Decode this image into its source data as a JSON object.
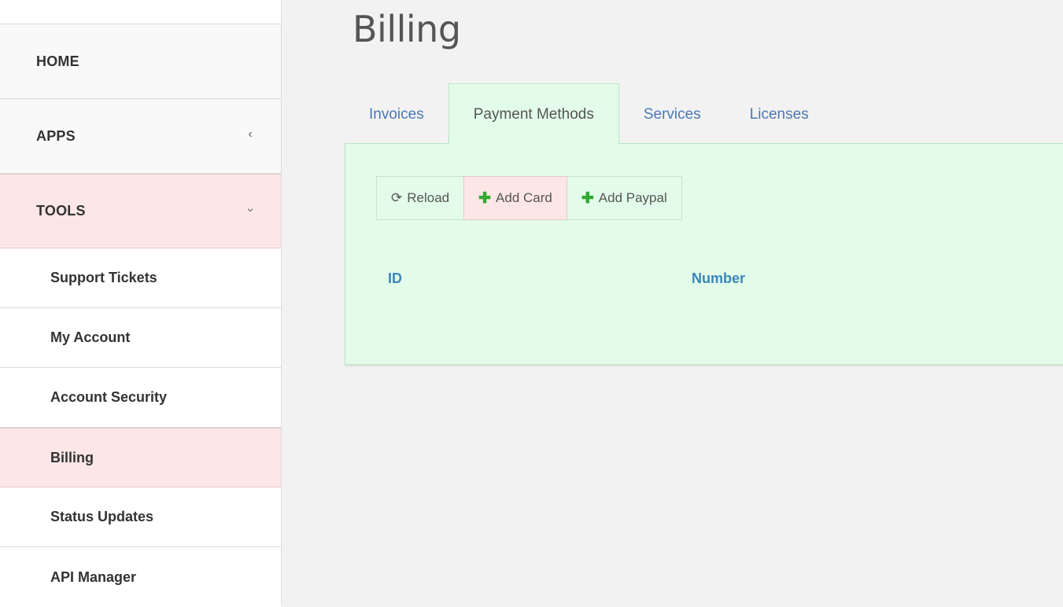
{
  "sidebar": {
    "items": [
      {
        "label": "HOME",
        "chevron": ""
      },
      {
        "label": "APPS",
        "chevron": "‹"
      },
      {
        "label": "TOOLS",
        "chevron": "›"
      }
    ],
    "subitems": [
      {
        "label": "Support Tickets"
      },
      {
        "label": "My Account"
      },
      {
        "label": "Account Security"
      },
      {
        "label": "Billing"
      },
      {
        "label": "Status Updates"
      },
      {
        "label": "API Manager"
      }
    ]
  },
  "page": {
    "title": "Billing"
  },
  "tabs": [
    {
      "label": "Invoices"
    },
    {
      "label": "Payment Methods"
    },
    {
      "label": "Services"
    },
    {
      "label": "Licenses"
    }
  ],
  "toolbar": {
    "reload_icon": "⟳",
    "reload_label": "Reload",
    "plus_icon": "✚",
    "add_card_label": "Add Card",
    "add_paypal_label": "Add Paypal"
  },
  "table": {
    "columns": [
      "ID",
      "Number"
    ]
  },
  "colors": {
    "active_red": "#fde6e6",
    "panel_green": "#e3fce9",
    "link_blue": "#4a78b5",
    "header_blue": "#3a86b8"
  }
}
